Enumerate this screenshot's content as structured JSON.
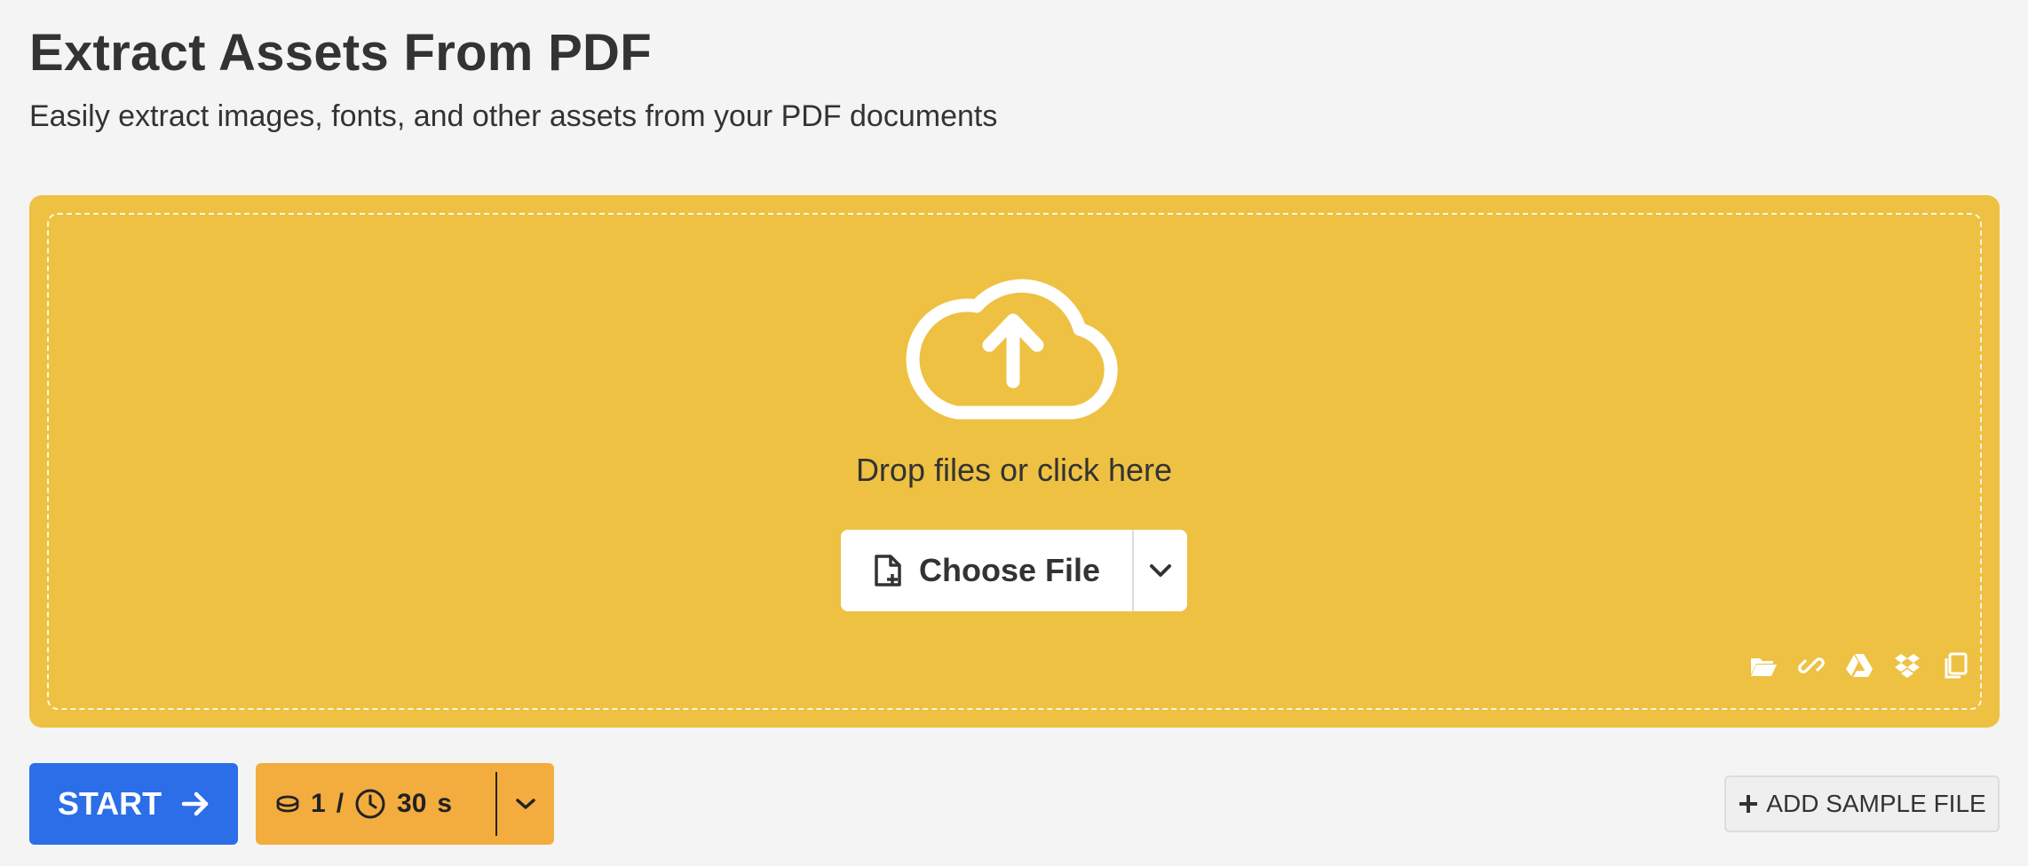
{
  "header": {
    "title": "Extract Assets From PDF",
    "subtitle": "Easily extract images, fonts, and other assets from your PDF documents"
  },
  "dropzone": {
    "prompt": "Drop files or click here",
    "choose_file_label": "Choose File",
    "source_icons": [
      "folder-open-icon",
      "link-icon",
      "google-drive-icon",
      "dropbox-icon",
      "clipboard-icon"
    ]
  },
  "actions": {
    "start_label": "START",
    "credits": "1",
    "separator": "/",
    "time": "30",
    "time_unit": "s",
    "add_sample_label": "ADD SAMPLE FILE"
  },
  "colors": {
    "dropzone": "#eec142",
    "start_button": "#2c6ee8",
    "cost_button": "#f3ac3e",
    "background": "#f4f4f4"
  }
}
